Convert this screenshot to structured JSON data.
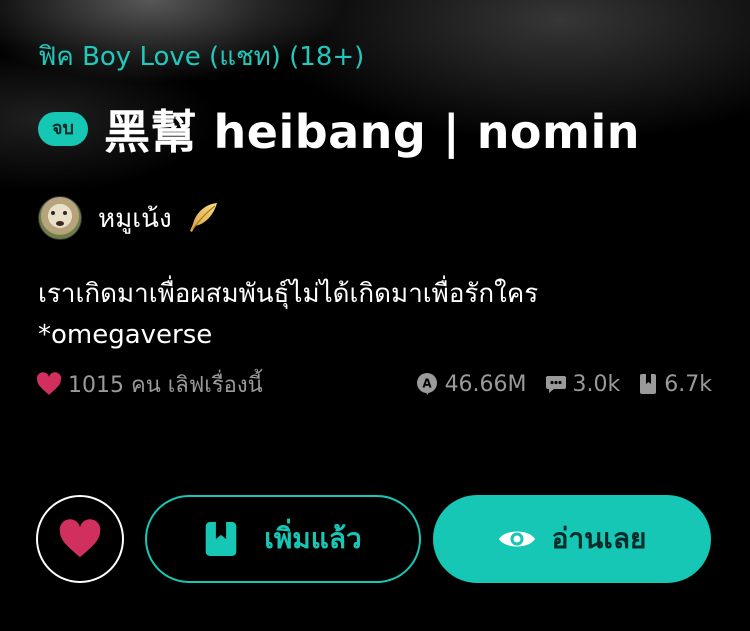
{
  "story": {
    "category": "ฟิค Boy Love (แชท) (18+)",
    "status_badge": "จบ",
    "title": "黑幫 heibang  | nomin",
    "author": "หมูเน้ง",
    "description_line1": "เราเกิดมาเพื่อผสมพันธุ์ไม่ได้เกิดมาเพื่อรักใคร",
    "description_line2": "*omegaverse"
  },
  "stats": {
    "likes": "1015 คน เลิฟเรื่องนี้",
    "views": "46.66M",
    "comments": "3.0k",
    "library": "6.7k"
  },
  "actions": {
    "library_label": "เพิ่มแล้ว",
    "read_label": "อ่านเลย"
  },
  "icons": {
    "author_badge": "feather-icon",
    "likes": "heart-icon",
    "views": "views-icon",
    "comments": "comment-icon",
    "library": "bookmark-icon",
    "read": "eye-icon"
  },
  "colors": {
    "accent": "#16c7b6",
    "heart": "#d1305f",
    "background": "#000000",
    "muted_text": "#9a9a9a"
  }
}
